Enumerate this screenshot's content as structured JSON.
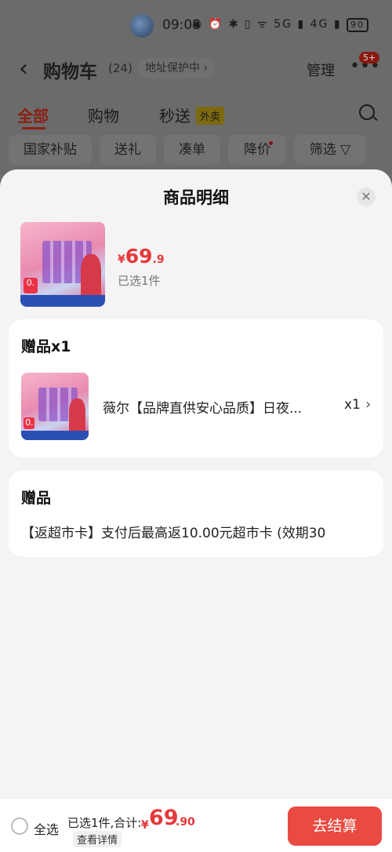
{
  "status_bar": {
    "time": "09:08",
    "battery": "90",
    "icons": "◉ ⏰ ✱ ▯ ᯤ 5G ▮ 4G ▮"
  },
  "header": {
    "back_icon": "chevron-left",
    "title": "购物车",
    "count": "(24)",
    "address_badge": "地址保护中",
    "manage_label": "管理",
    "more_badge": "5+"
  },
  "tabs": [
    {
      "label": "全部",
      "active": true
    },
    {
      "label": "购物",
      "active": false
    },
    {
      "label": "秒送",
      "active": false,
      "tag": "外卖"
    }
  ],
  "filter_chips": [
    {
      "label": "国家补贴"
    },
    {
      "label": "送礼"
    },
    {
      "label": "凑单"
    },
    {
      "label": "降价",
      "dot": true
    },
    {
      "label": "筛选"
    }
  ],
  "sheet": {
    "title": "商品明细",
    "product": {
      "price_currency": "¥",
      "price_integer": "69",
      "price_decimal": ".9",
      "selected_text": "已选1件"
    },
    "gift_card": {
      "title": "赠品x1",
      "item_name": "薇尔【品牌直供安心品质】日夜...",
      "quantity": "x1"
    },
    "gift_text_card": {
      "title": "赠品",
      "text": "【返超市卡】支付后最高返10.00元超市卡 (效期30"
    }
  },
  "bottom_bar": {
    "select_all": "全选",
    "summary": "已选1件,合计:",
    "total_currency": "¥",
    "total_integer": "69",
    "total_decimal": ".90",
    "details": "查看详情",
    "checkout": "去结算"
  },
  "colors": {
    "accent": "#e4393c",
    "checkout_bg": "#e94a42"
  }
}
